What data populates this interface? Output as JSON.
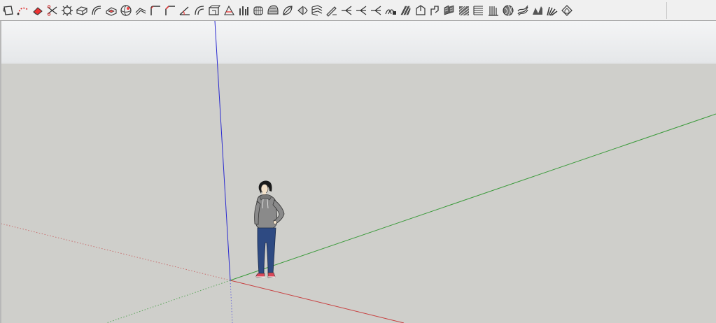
{
  "app": {
    "toolbar": {
      "tools": [
        {
          "name": "select-rectangle-icon",
          "glyph": "rect"
        },
        {
          "name": "dotted-curve-icon",
          "glyph": "curve"
        },
        {
          "name": "eraser-icon",
          "glyph": "eraser"
        },
        {
          "name": "scissors-icon",
          "glyph": "scissors"
        },
        {
          "name": "gear-shape-icon",
          "glyph": "gear"
        },
        {
          "name": "joint-push-pull-icon",
          "glyph": "push"
        },
        {
          "name": "bend-tool-icon",
          "glyph": "bend"
        },
        {
          "name": "shell-icon",
          "glyph": "shell"
        },
        {
          "name": "sphere-icon",
          "glyph": "sphere"
        },
        {
          "name": "follow-me-icon",
          "glyph": "follow"
        },
        {
          "name": "fillet-icon",
          "glyph": "fillet"
        },
        {
          "name": "chamfer-icon",
          "glyph": "chamfer"
        },
        {
          "name": "angle-line-icon",
          "glyph": "angle"
        },
        {
          "name": "curve-offset-icon",
          "glyph": "offset"
        },
        {
          "name": "building-block-icon",
          "glyph": "block"
        },
        {
          "name": "section-cut-icon",
          "glyph": "section"
        },
        {
          "name": "piped-columns-icon",
          "glyph": "pipes"
        },
        {
          "name": "grid-cage-icon",
          "glyph": "cage"
        },
        {
          "name": "helmet-mesh-icon",
          "glyph": "helmet"
        },
        {
          "name": "leaf-shape-icon",
          "glyph": "leaf"
        },
        {
          "name": "left-rotate-icon",
          "glyph": "rotate"
        },
        {
          "name": "layered-surface-icon",
          "glyph": "layers"
        },
        {
          "name": "pencil-surface-icon",
          "glyph": "pencil"
        },
        {
          "name": "branch-split-icon",
          "glyph": "branch"
        },
        {
          "name": "branch-join-icon",
          "glyph": "branch"
        },
        {
          "name": "branch-merge-icon",
          "glyph": "branch"
        },
        {
          "name": "loft-surface-icon",
          "glyph": "loft"
        },
        {
          "name": "extrude-surface-icon",
          "glyph": "extrude"
        },
        {
          "name": "fold-panel-icon",
          "glyph": "fold"
        },
        {
          "name": "hook-shape-icon",
          "glyph": "hook"
        },
        {
          "name": "stripe-panel-icon",
          "glyph": "stripe"
        },
        {
          "name": "hatched-mesh-icon",
          "glyph": "hatch"
        },
        {
          "name": "stacked-lines-icon",
          "glyph": "stack"
        },
        {
          "name": "comb-lines-icon",
          "glyph": "comb"
        },
        {
          "name": "spiral-ball-icon",
          "glyph": "spiral"
        },
        {
          "name": "twisted-mesh-icon",
          "glyph": "twist"
        },
        {
          "name": "wave-surface-icon",
          "glyph": "wave"
        },
        {
          "name": "striped-fan-icon",
          "glyph": "fan"
        },
        {
          "name": "house-outline-icon",
          "glyph": "house"
        }
      ]
    },
    "viewport": {
      "sky_color": "#e6e8ea",
      "ground_color": "#cfcfcb",
      "axes": {
        "red": "#c84040",
        "green": "#3a9a3a",
        "blue": "#2a2ad0"
      },
      "scale_figure": {
        "name": "person-scale-figure"
      }
    }
  }
}
